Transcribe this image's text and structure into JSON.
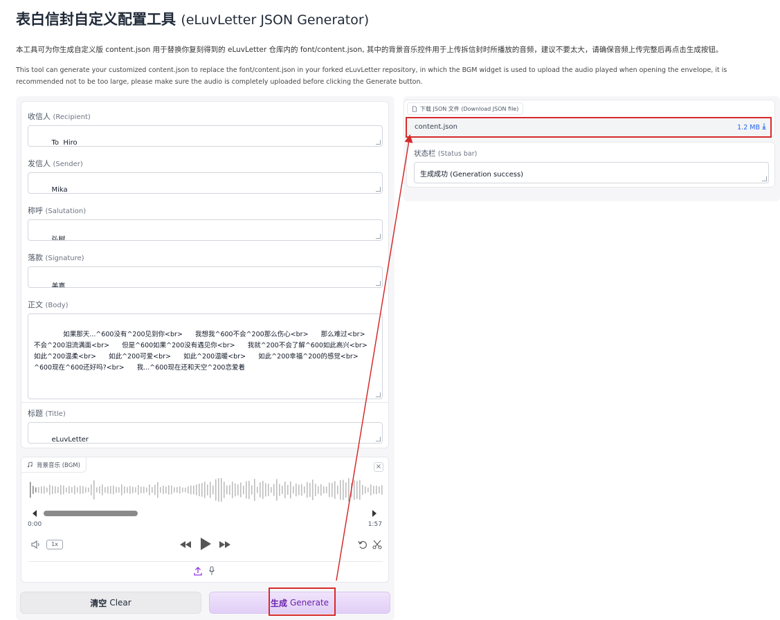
{
  "header": {
    "title_cn": "表白信封自定义配置工具",
    "title_en": "(eLuvLetter JSON Generator)",
    "desc_cn": "本工具可为你生成自定义版 content.json 用于替换你复刻得到的 eLuvLetter 仓库内的 font/content.json, 其中的背景音乐控件用于上传拆信封时所播放的音频，建议不要太大，请确保音频上传完整后再点击生成按钮。",
    "desc_en": "This tool can generate your customized content.json to replace the font/content.json in your forked eLuvLetter repository, in which the BGM widget is used to upload the audio played when opening the envelope, it is recommended not to be too large, please make sure the audio is completely uploaded before clicking the Generate button."
  },
  "form": {
    "recipient": {
      "label_cn": "收信人",
      "label_en": "(Recipient)",
      "value": "To  Hiro"
    },
    "sender": {
      "label_cn": "发信人",
      "label_en": "(Sender)",
      "value": "Mika"
    },
    "salutation": {
      "label_cn": "称呼",
      "label_en": "(Salutation)",
      "value": "弘树"
    },
    "signature": {
      "label_cn": "落款",
      "label_en": "(Signature)",
      "value": "美嘉"
    },
    "body": {
      "label_cn": "正文",
      "label_en": "(Body)",
      "value": "      如果那天...^600没有^200见到你<br>      我想我^600不会^200那么伤心<br>      那么难过<br>      不会^200泪流满面<br>      但是^600如果^200没有遇见你<br>      我就^200不会了解^600如此高兴<br>      如此^200温柔<br>      如此^200可爱<br>      如此^200温暖<br>      如此^200幸福^200的感觉<br>      ^600现在^600还好吗?<br>      我...^600现在还和天空^200恋爱着"
    },
    "title": {
      "label_cn": "标题",
      "label_en": "(Title)",
      "value": "eLuvLetter"
    }
  },
  "audio": {
    "label": "背景音乐 (BGM)",
    "time_start": "0:00",
    "time_end": "1:57",
    "speed": "1x",
    "progress": 0.3,
    "icons": [
      "music-icon",
      "close-icon",
      "volume-icon",
      "rewind-icon",
      "play-icon",
      "forward-icon",
      "undo-icon",
      "scissors-icon",
      "upload-icon",
      "microphone-icon"
    ]
  },
  "buttons": {
    "clear_cn": "清空",
    "clear_en": "Clear",
    "generate_cn": "生成",
    "generate_en": "Generate"
  },
  "download": {
    "label": "下载 JSON 文件 (Download JSON file)",
    "filename": "content.json",
    "size": "1.2 MB",
    "icons": [
      "file-icon",
      "download-icon"
    ]
  },
  "status": {
    "label_cn": "状态栏",
    "label_en": "(Status bar)",
    "value": "生成成功 (Generation success)"
  },
  "colors": {
    "highlight": "#d62a2a",
    "generate_text": "#6b21a8",
    "link_blue": "#2563eb"
  }
}
